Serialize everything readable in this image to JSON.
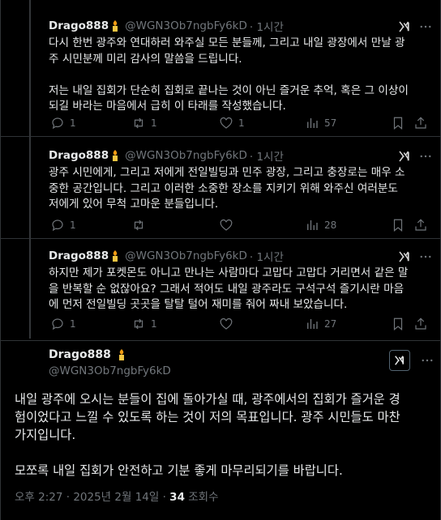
{
  "replies": [
    {
      "name": "Drago888",
      "handle": "@WGN3Ob7ngbFy6kD",
      "time": "· 1시간",
      "text": "다시 한번 광주와 연대하러 와주실 모든 분들께, 그리고 내일 광장에서 만날 광\n주 시민분께 미리 감사의 말씀을 드립니다.\n\n저는 내일 집회가 단순히 집회로 끝나는 것이 아닌 즐거운 추억, 혹은 그 이상이\n되길 바라는 마음에서 급히 이 타래를 작성했습니다.",
      "replies_count": "1",
      "reposts_count": "1",
      "likes_count": "1",
      "views_count": "57"
    },
    {
      "name": "Drago888",
      "handle": "@WGN3Ob7ngbFy6kD",
      "time": "· 1시간",
      "text": "광주 시민에게, 그리고 저에게 전일빌딩과 민주 광장, 그리고 충장로는 매우 소\n중한 공간입니다. 그리고 이러한 소중한 장소를 지키기 위해 와주신 여러분도\n저에게 있어 무척 고마운 분들입니다.",
      "replies_count": "1",
      "reposts_count": "",
      "likes_count": "",
      "views_count": "28"
    },
    {
      "name": "Drago888",
      "handle": "@WGN3Ob7ngbFy6kD",
      "time": "· 1시간",
      "text": "하지만 제가 포켓몬도 아니고 만나는 사람마다 고맙다 고맙다 거리면서 같은 말\n을 반복할 순 없잖아요? 그래서 적어도 내일 광주라도 구석구석 즐기시란 마음\n에 먼저 전일빌딩 곳곳을 탈탈 털어 재미를 줘어 짜내 보았습니다.",
      "replies_count": "1",
      "reposts_count": "1",
      "likes_count": "",
      "views_count": "27"
    }
  ],
  "main": {
    "name": "Drago888",
    "handle": "@WGN3Ob7ngbFy6kD",
    "text": "내일 광주에 오시는 분들이 집에 돌아가실 때, 광주에서의 집회가 즐거운 경\n험이었다고 느낄 수 있도록 하는 것이 저의 목표입니다. 광주 시민들도 마찬\n가지입니다.\n\n모쪼록 내일 집회가 안전하고 기분 좋게 마무리되기를 바랍니다.",
    "timestamp": "오후 2:27 · 2025년 2월 14일 ·",
    "views_count": "34",
    "views_label": "조회수"
  },
  "colors": {
    "background": "#000000",
    "text": "#e7e9ea",
    "muted": "#71767b",
    "divider": "#2f3336"
  },
  "icons": [
    "reply-icon",
    "repost-icon",
    "like-icon",
    "views-icon",
    "bookmark-icon",
    "share-icon",
    "xi-logo-icon",
    "more-icon",
    "flame-icon"
  ]
}
